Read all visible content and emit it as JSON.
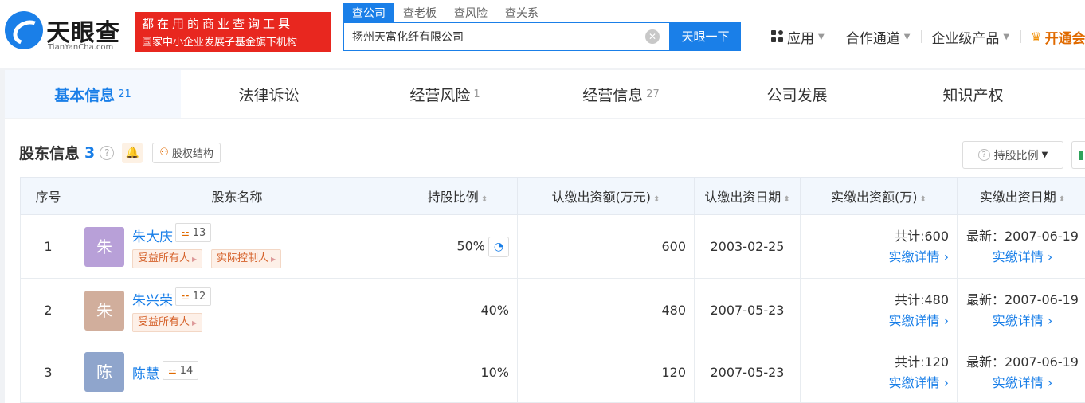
{
  "brand": {
    "name": "天眼查",
    "site": "TianYanCha.com"
  },
  "slogan": {
    "line1": "都在用的商业查询工具",
    "line2": "国家中小企业发展子基金旗下机构"
  },
  "search": {
    "tabs": [
      {
        "label": "查公司",
        "active": true
      },
      {
        "label": "查老板",
        "active": false
      },
      {
        "label": "查风险",
        "active": false
      },
      {
        "label": "查关系",
        "active": false
      }
    ],
    "value": "扬州天富化纤有限公司",
    "button": "天眼一下"
  },
  "topnav": {
    "apps": "应用",
    "cooperation": "合作通道",
    "enterprise": "企业级产品",
    "vip": "开通会"
  },
  "tabs": [
    {
      "label": "基本信息",
      "count": "21"
    },
    {
      "label": "法律诉讼",
      "count": ""
    },
    {
      "label": "经营风险",
      "count": "1"
    },
    {
      "label": "经营信息",
      "count": "27"
    },
    {
      "label": "公司发展",
      "count": ""
    },
    {
      "label": "知识产权",
      "count": ""
    }
  ],
  "section": {
    "title": "股东信息",
    "count": "3",
    "help": "?",
    "equity_button": "股权结构",
    "ratio_dropdown": "持股比例"
  },
  "table": {
    "headers": {
      "index": "序号",
      "name": "股东名称",
      "ratio": "持股比例",
      "subscribed_amount": "认缴出资额(万元)",
      "subscribed_date": "认缴出资日期",
      "paid_amount": "实缴出资额(万)",
      "paid_date": "实缴出资日期"
    },
    "rows": [
      {
        "index": "1",
        "avatar": "朱",
        "avatar_color": "#b8a0d8",
        "name": "朱大庆",
        "relations": "13",
        "tags": [
          "受益所有人",
          "实际控制人"
        ],
        "ratio": "50%",
        "subscribed_amount": "600",
        "subscribed_date": "2003-02-25",
        "paid_total": "共计:600",
        "paid_link": "实缴详情",
        "paid_latest": "最新：2007-06-19",
        "paid_date_link": "实缴详情"
      },
      {
        "index": "2",
        "avatar": "朱",
        "avatar_color": "#d1ae9c",
        "name": "朱兴荣",
        "relations": "12",
        "tags": [
          "受益所有人"
        ],
        "ratio": "40%",
        "subscribed_amount": "480",
        "subscribed_date": "2007-05-23",
        "paid_total": "共计:480",
        "paid_link": "实缴详情",
        "paid_latest": "最新：2007-06-19",
        "paid_date_link": "实缴详情"
      },
      {
        "index": "3",
        "avatar": "陈",
        "avatar_color": "#8fa5cc",
        "name": "陈慧",
        "relations": "14",
        "tags": [],
        "ratio": "10%",
        "subscribed_amount": "120",
        "subscribed_date": "2007-05-23",
        "paid_total": "共计:120",
        "paid_link": "实缴详情",
        "paid_latest": "最新：2007-06-19",
        "paid_date_link": "实缴详情"
      }
    ]
  },
  "colors": {
    "accent": "#1a7fe8",
    "brand_red": "#e8271f",
    "tag_text": "#d5622b"
  }
}
